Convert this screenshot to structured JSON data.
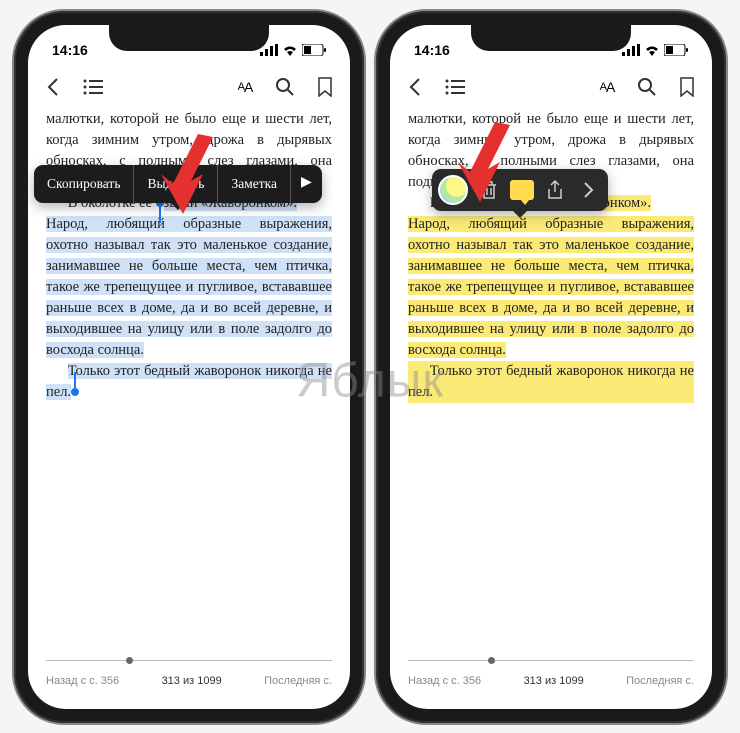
{
  "status": {
    "time": "14:16"
  },
  "text": {
    "line1": "малютки, которой не было еще и шести лет, когда зимним утром, дрожа в дырявых обносках, с полными слез глазами, она подметала",
    "line2_a": "В околотке ее ",
    "line2_b": "звали «Жаворонком».",
    "para2": "Народ, любящий образные выражения, охотно называл так это маленькое создание, занимавшее не больше места, чем птичка, такое же трепещущее и пугливое, встававшее раньше всех в доме, да и во всей деревне, и выходившее на улицу или в поле задолго до восхода солнца.",
    "para3": "Только этот бедный жаворонок никогда не пел."
  },
  "popover": {
    "copy": "Скопировать",
    "highlight": "Выделить",
    "note": "Заметка"
  },
  "nav": {
    "back": "Назад с с. 356",
    "page": "313 из 1099",
    "last": "Последняя с."
  },
  "watermark": "Яблык"
}
